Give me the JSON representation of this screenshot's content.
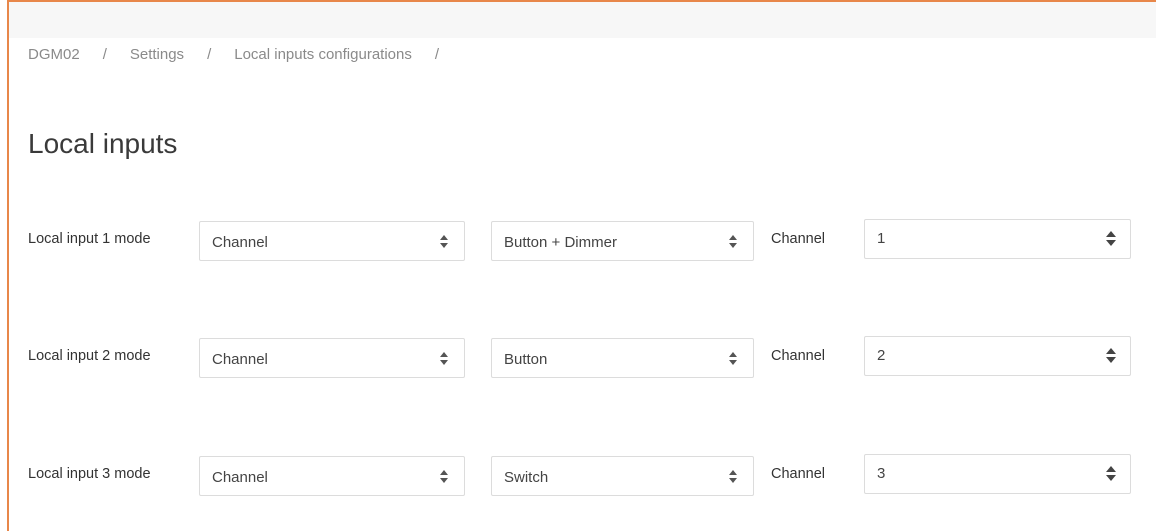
{
  "breadcrumb": {
    "items": [
      "DGM02",
      "Settings",
      "Local inputs configurations"
    ],
    "separator": "/"
  },
  "page": {
    "title": "Local inputs"
  },
  "rows": [
    {
      "label": "Local input 1 mode",
      "mode": "Channel",
      "type": "Button + Dimmer",
      "channel_label": "Channel",
      "channel_value": "1"
    },
    {
      "label": "Local input 2 mode",
      "mode": "Channel",
      "type": "Button",
      "channel_label": "Channel",
      "channel_value": "2"
    },
    {
      "label": "Local input 3 mode",
      "mode": "Channel",
      "type": "Switch",
      "channel_label": "Channel",
      "channel_value": "3"
    }
  ],
  "colors": {
    "frame_accent": "#e8874a",
    "text": "#333333",
    "muted_text": "#8a8a8a",
    "border": "#dcdcdc"
  },
  "icons": {
    "select_arrows": "sort-arrows-icon",
    "number_spinner": "spinner-arrows-icon"
  }
}
